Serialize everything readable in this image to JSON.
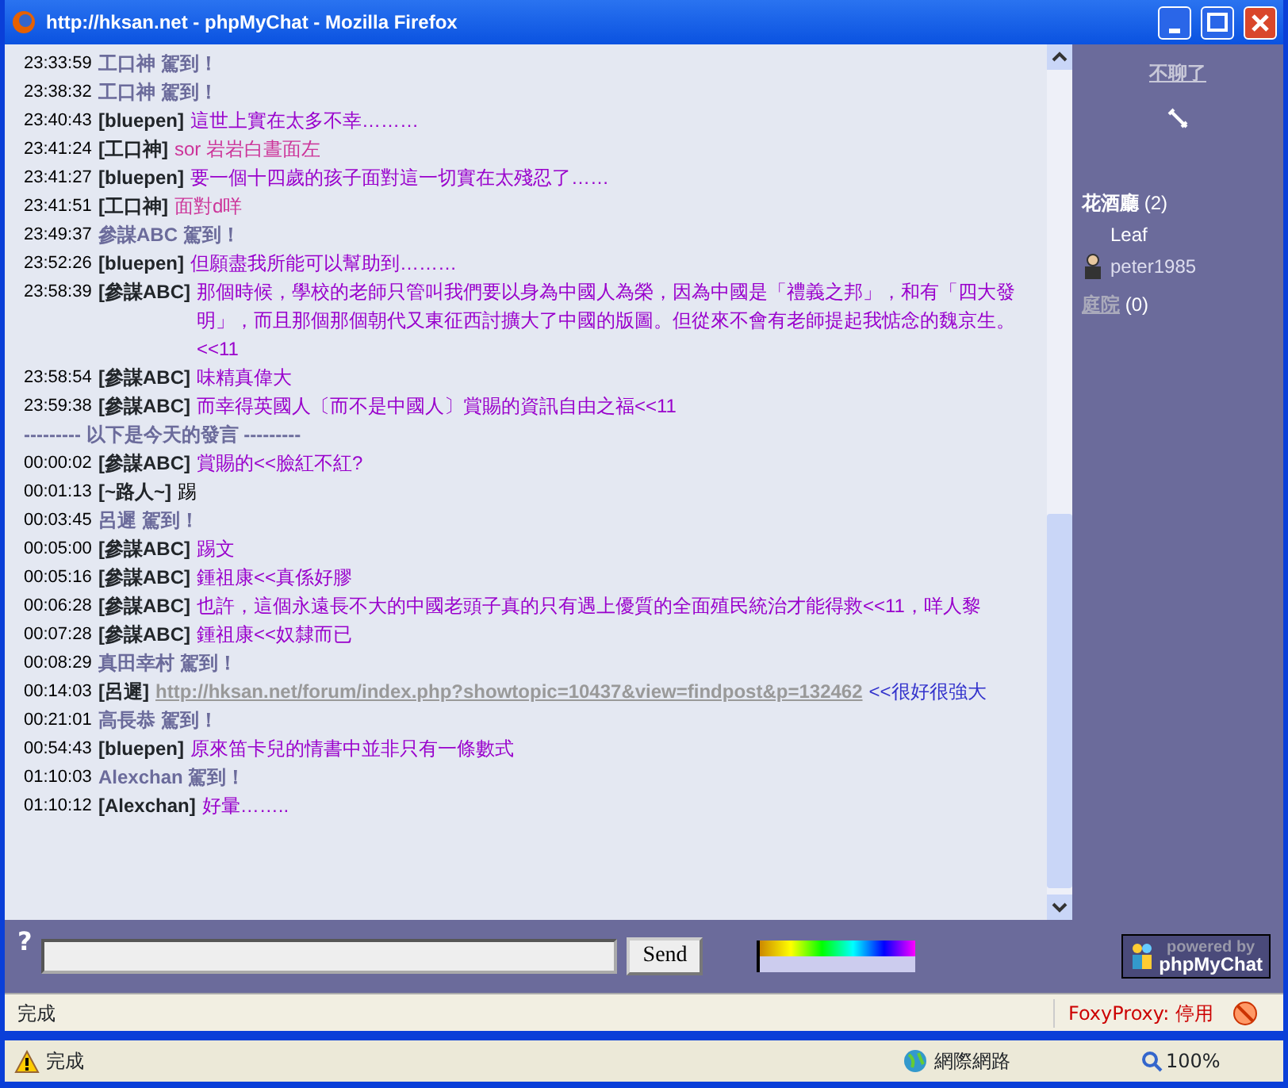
{
  "window": {
    "title": "http://hksan.net - phpMyChat - Mozilla Firefox"
  },
  "messages": [
    {
      "kind": "join",
      "time": "23:33:59",
      "user": "工口神",
      "text": "駕到！"
    },
    {
      "kind": "join",
      "time": "23:38:32",
      "user": "工口神",
      "text": "駕到！"
    },
    {
      "kind": "msg",
      "time": "23:40:43",
      "user": "[bluepen]",
      "text": "這世上實在太多不幸………",
      "color": "#9900cc"
    },
    {
      "kind": "msg",
      "time": "23:41:24",
      "user": "[工口神]",
      "text": "sor 岩岩白晝面左",
      "color": "#cc3399"
    },
    {
      "kind": "msg",
      "time": "23:41:27",
      "user": "[bluepen]",
      "text": "要一個十四歲的孩子面對這一切實在太殘忍了……",
      "color": "#9900cc"
    },
    {
      "kind": "msg",
      "time": "23:41:51",
      "user": "[工口神]",
      "text": "面對d咩",
      "color": "#cc3399"
    },
    {
      "kind": "join",
      "time": "23:49:37",
      "user": "參謀ABC",
      "text": "駕到！"
    },
    {
      "kind": "msg",
      "time": "23:52:26",
      "user": "[bluepen]",
      "text": "但願盡我所能可以幫助到………",
      "color": "#9900cc"
    },
    {
      "kind": "msg",
      "time": "23:58:39",
      "user": "[參謀ABC]",
      "text": "那個時候，學校的老師只管叫我們要以身為中國人為榮，因為中國是「禮義之邦」，和有「四大發明」，而且那個那個朝代又東征西討擴大了中國的版圖。但從來不會有老師提起我惦念的魏京生。 <<11",
      "color": "#9900cc"
    },
    {
      "kind": "msg",
      "time": "23:58:54",
      "user": "[參謀ABC]",
      "text": "味精真偉大",
      "color": "#9900cc"
    },
    {
      "kind": "msg",
      "time": "23:59:38",
      "user": "[參謀ABC]",
      "text": "而幸得英國人〔而不是中國人〕賞賜的資訊自由之福<<11",
      "color": "#9900cc"
    },
    {
      "kind": "divider",
      "text": "--------- 以下是今天的發言 ---------"
    },
    {
      "kind": "msg",
      "time": "00:00:02",
      "user": "[參謀ABC]",
      "text": "賞賜的<<臉紅不紅?",
      "color": "#9900cc"
    },
    {
      "kind": "msg",
      "time": "00:01:13",
      "user": "[~路人~]",
      "text": "踢",
      "color": "#000000"
    },
    {
      "kind": "join",
      "time": "00:03:45",
      "user": "呂遲",
      "text": "駕到！"
    },
    {
      "kind": "msg",
      "time": "00:05:00",
      "user": "[參謀ABC]",
      "text": "踢文",
      "color": "#9900cc"
    },
    {
      "kind": "msg",
      "time": "00:05:16",
      "user": "[參謀ABC]",
      "text": "鍾祖康<<真係好膠",
      "color": "#9900cc"
    },
    {
      "kind": "msg",
      "time": "00:06:28",
      "user": "[參謀ABC]",
      "text": "也許，這個永遠長不大的中國老頭子真的只有遇上優質的全面殖民統治才能得救<<11，咩人黎",
      "color": "#9900cc"
    },
    {
      "kind": "msg",
      "time": "00:07:28",
      "user": "[參謀ABC]",
      "text": "鍾祖康<<奴隸而已",
      "color": "#9900cc"
    },
    {
      "kind": "join",
      "time": "00:08:29",
      "user": "真田幸村",
      "text": "駕到！"
    },
    {
      "kind": "link",
      "time": "00:14:03",
      "user": "[呂遲]",
      "link": "http://hksan.net/forum/index.php?showtopic=10437&view=findpost&p=132462",
      "text": "<<很好很強大",
      "color": "#3333cc"
    },
    {
      "kind": "join",
      "time": "00:21:01",
      "user": "高長恭",
      "text": "駕到！"
    },
    {
      "kind": "msg",
      "time": "00:54:43",
      "user": "[bluepen]",
      "text": "原來笛卡兒的情書中並非只有一條數式",
      "color": "#9900cc"
    },
    {
      "kind": "join",
      "time": "01:10:03",
      "user": "Alexchan",
      "text": "駕到！"
    },
    {
      "kind": "msg",
      "time": "01:10:12",
      "user": "[Alexchan]",
      "text": "好暈……..",
      "color": "#9900cc"
    }
  ],
  "sidebar": {
    "quit_link": "不聊了",
    "rooms": [
      {
        "name": "花酒廳",
        "count": "(2)",
        "selected": true,
        "users": [
          {
            "name": "Leaf",
            "avatar": false
          },
          {
            "name": "peter1985",
            "avatar": true
          }
        ]
      },
      {
        "name": "庭院",
        "count": "(0)",
        "selected": false
      }
    ]
  },
  "input_bar": {
    "help": "?",
    "send": "Send",
    "logo_top": "powered by",
    "logo_bottom": "phpMyChat"
  },
  "status_bar": {
    "text": "完成",
    "proxy": "FoxyProxy: 停用"
  },
  "ie_status_bar": {
    "text": "完成",
    "zone": "網際網路",
    "zoom": "100%"
  }
}
